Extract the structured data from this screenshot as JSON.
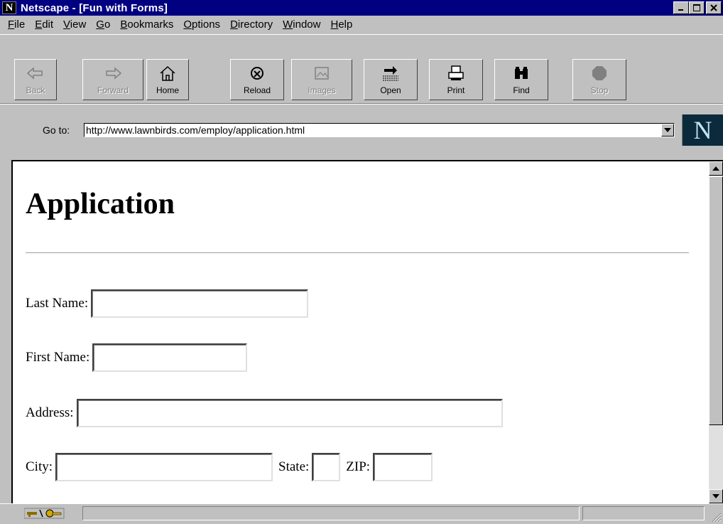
{
  "window": {
    "title": "Netscape - [Fun with Forms]",
    "app_icon": "N",
    "controls": [
      "minimize",
      "maximize",
      "close"
    ]
  },
  "menu": [
    {
      "label": "File",
      "accel": "F",
      "rest": "ile"
    },
    {
      "label": "Edit",
      "accel": "E",
      "rest": "dit"
    },
    {
      "label": "View",
      "accel": "V",
      "rest": "iew"
    },
    {
      "label": "Go",
      "accel": "G",
      "rest": "o"
    },
    {
      "label": "Bookmarks",
      "accel": "B",
      "rest": "ookmarks"
    },
    {
      "label": "Options",
      "accel": "O",
      "rest": "ptions"
    },
    {
      "label": "Directory",
      "accel": "D",
      "rest": "irectory"
    },
    {
      "label": "Window",
      "accel": "W",
      "rest": "indow"
    },
    {
      "label": "Help",
      "accel": "H",
      "rest": "elp"
    }
  ],
  "toolbar": {
    "back": {
      "label": "Back",
      "icon": "back-arrow-icon",
      "enabled": false
    },
    "forward": {
      "label": "Forward",
      "icon": "forward-arrow-icon",
      "enabled": false
    },
    "home": {
      "label": "Home",
      "icon": "home-icon",
      "enabled": true
    },
    "reload": {
      "label": "Reload",
      "icon": "reload-icon",
      "enabled": true
    },
    "images": {
      "label": "Images",
      "icon": "images-icon",
      "enabled": false
    },
    "open": {
      "label": "Open",
      "icon": "open-icon",
      "enabled": true
    },
    "print": {
      "label": "Print",
      "icon": "printer-icon",
      "enabled": true
    },
    "find": {
      "label": "Find",
      "icon": "binoculars-icon",
      "enabled": true
    },
    "stop": {
      "label": "Stop",
      "icon": "stop-sign-icon",
      "enabled": false
    }
  },
  "location": {
    "label": "Go to:",
    "url": "http://www.lawnbirds.com/employ/application.html"
  },
  "logo": "N",
  "page": {
    "heading": "Application",
    "fields": {
      "last_name": "Last Name:",
      "first_name": "First Name:",
      "address": "Address:",
      "city": "City:",
      "state": "State:",
      "zip": "ZIP:"
    }
  },
  "colors": {
    "titlebar": "#000080",
    "chrome": "#c0c0c0",
    "content_bg": "#ffffff"
  }
}
